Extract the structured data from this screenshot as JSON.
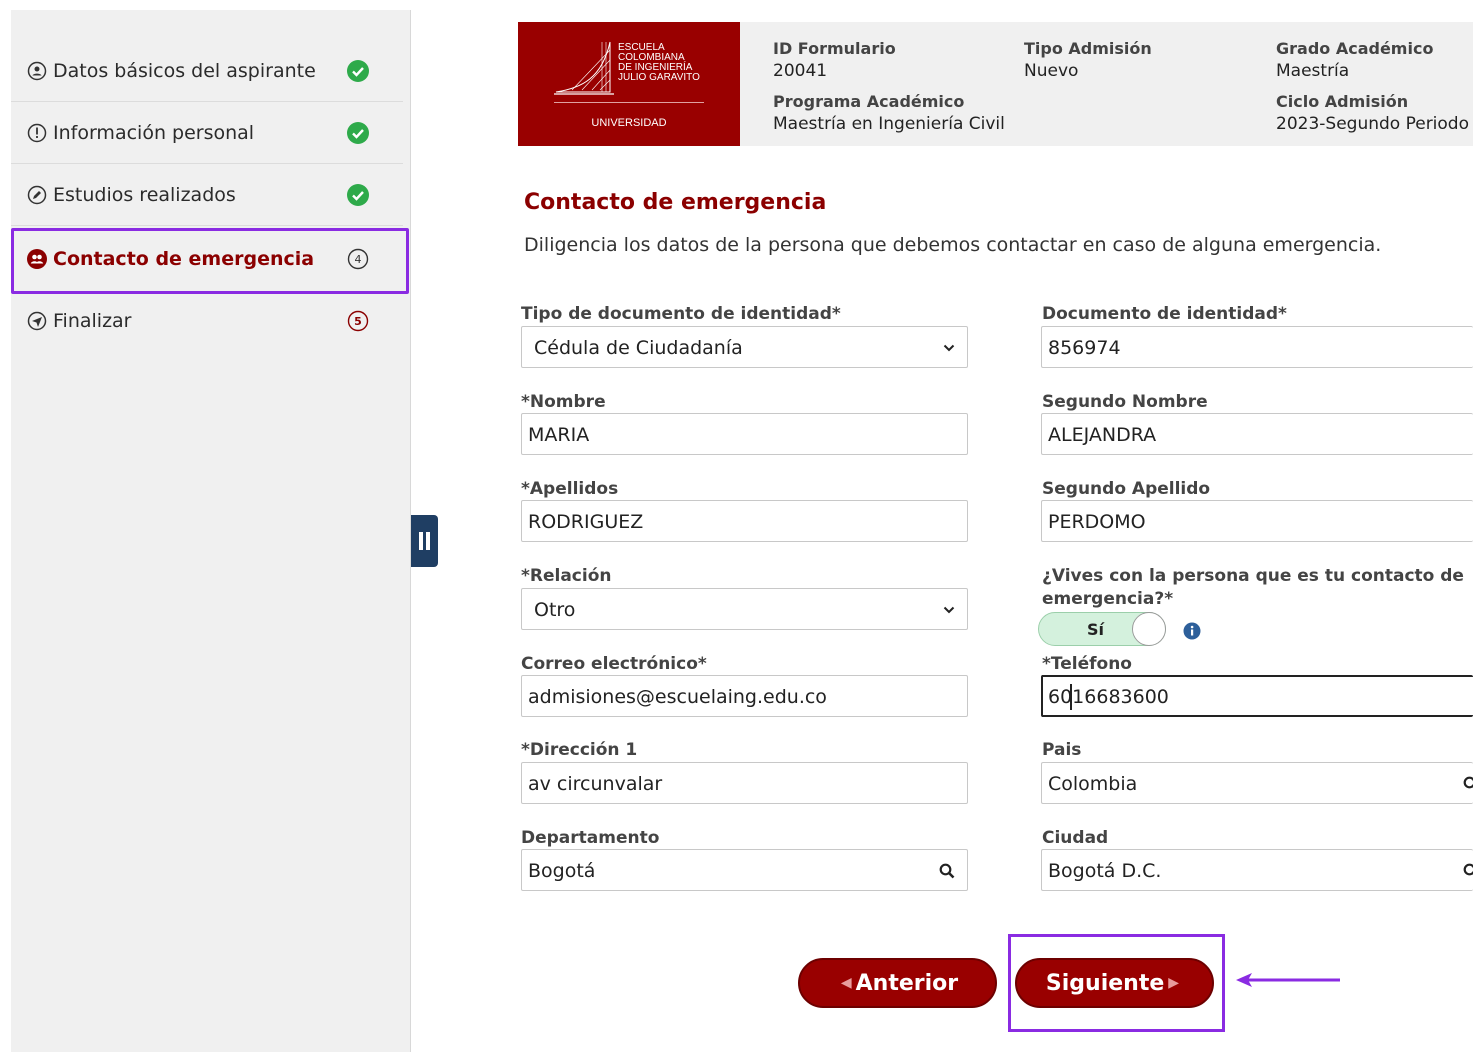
{
  "sidebar": {
    "items": [
      {
        "label": "Datos básicos del aspirante",
        "status": "done"
      },
      {
        "label": "Información personal",
        "status": "done"
      },
      {
        "label": "Estudios realizados",
        "status": "done"
      },
      {
        "label": "Contacto de emergencia",
        "status": "current",
        "number": "4"
      },
      {
        "label": "Finalizar",
        "status": "pending",
        "number": "5"
      }
    ]
  },
  "header": {
    "logo_lines": [
      "Escuela",
      "Colombiana",
      "de Ingeniería",
      "Julio Garavito"
    ],
    "logo_sub": "UNIVERSIDAD",
    "id_formulario_label": "ID Formulario",
    "id_formulario": "20041",
    "tipo_admision_label": "Tipo Admisión",
    "tipo_admision": "Nuevo",
    "grado_label": "Grado Académico",
    "grado": "Maestría",
    "programa_label": "Programa Académico",
    "programa": "Maestría en Ingeniería Civil",
    "ciclo_label": "Ciclo Admisión",
    "ciclo": "2023-Segundo Periodo"
  },
  "section": {
    "title": "Contacto de emergencia",
    "description": "Diligencia los datos de la persona que debemos contactar en caso de alguna emergencia."
  },
  "form": {
    "tipo_doc": {
      "label": "Tipo de documento de identidad*",
      "value": "Cédula de Ciudadanía"
    },
    "documento": {
      "label": "Documento de identidad*",
      "value": "856974"
    },
    "nombre": {
      "label": "*Nombre",
      "value": "MARIA"
    },
    "segundo_nombre": {
      "label": "Segundo Nombre",
      "value": "ALEJANDRA"
    },
    "apellidos": {
      "label": "*Apellidos",
      "value": "RODRIGUEZ"
    },
    "segundo_apellido": {
      "label": "Segundo Apellido",
      "value": "PERDOMO"
    },
    "relacion": {
      "label": "*Relación",
      "value": "Otro"
    },
    "vives": {
      "label_line1": "¿Vives con la persona que es tu contacto de",
      "label_line2": "emergencia?*",
      "value": "Sí"
    },
    "correo": {
      "label": "Correo electrónico*",
      "value": "admisiones@escuelaing.edu.co"
    },
    "telefono": {
      "label": "*Teléfono",
      "value": "6016683600"
    },
    "direccion": {
      "label": "*Dirección 1",
      "value": "av circunvalar"
    },
    "pais": {
      "label": "Pais",
      "value": "Colombia"
    },
    "departamento": {
      "label": "Departamento",
      "value": "Bogotá"
    },
    "ciudad": {
      "label": "Ciudad",
      "value": "Bogotá D.C."
    }
  },
  "buttons": {
    "previous": "Anterior",
    "next": "Siguiente"
  },
  "colors": {
    "brand": "#990000",
    "title": "#8b0000",
    "highlight": "#8a2be2",
    "check": "#2eaa4a",
    "toggle_bg": "#d4f1dd",
    "handle": "#1f3e63"
  }
}
